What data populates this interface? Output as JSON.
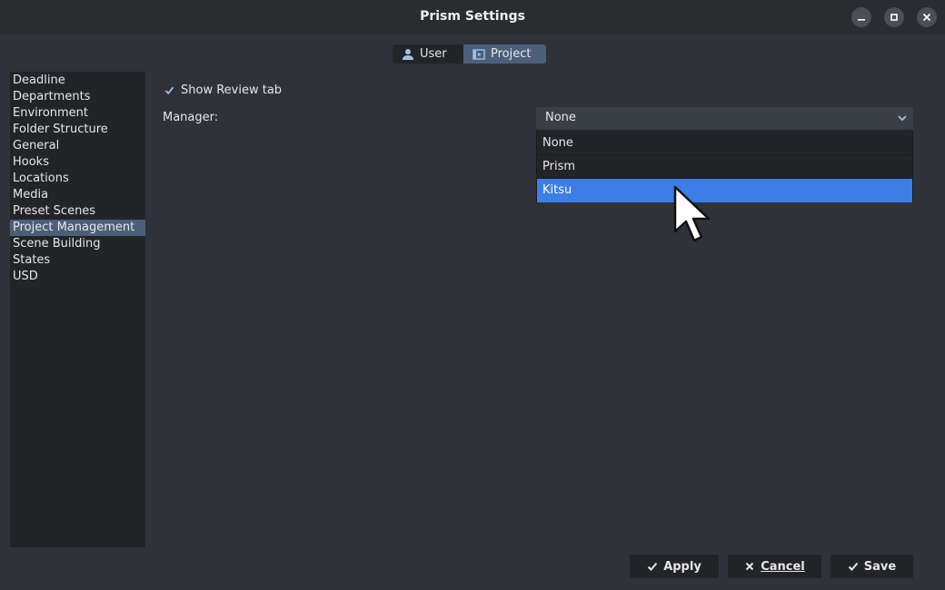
{
  "window": {
    "title": "Prism Settings"
  },
  "tabs": [
    {
      "label": "User",
      "icon": "user-icon"
    },
    {
      "label": "Project",
      "icon": "project-icon",
      "selected": true
    }
  ],
  "sidebar": {
    "items": [
      {
        "label": "Deadline"
      },
      {
        "label": "Departments"
      },
      {
        "label": "Environment"
      },
      {
        "label": "Folder Structure"
      },
      {
        "label": "General"
      },
      {
        "label": "Hooks"
      },
      {
        "label": "Locations"
      },
      {
        "label": "Media"
      },
      {
        "label": "Preset Scenes"
      },
      {
        "label": "Project Management",
        "selected": true
      },
      {
        "label": "Scene Building"
      },
      {
        "label": "States"
      },
      {
        "label": "USD"
      }
    ]
  },
  "main": {
    "show_review_tab": {
      "label": "Show Review tab",
      "checked": true
    },
    "manager": {
      "label": "Manager:",
      "value": "None",
      "options": [
        "None",
        "Prism",
        "Kitsu"
      ],
      "highlighted": "Kitsu"
    }
  },
  "buttons": {
    "apply": "Apply",
    "cancel": "Cancel",
    "save": "Save"
  },
  "colors": {
    "accent": "#3c7de6",
    "selection": "#4c5f7a",
    "background": "#2f3238"
  }
}
